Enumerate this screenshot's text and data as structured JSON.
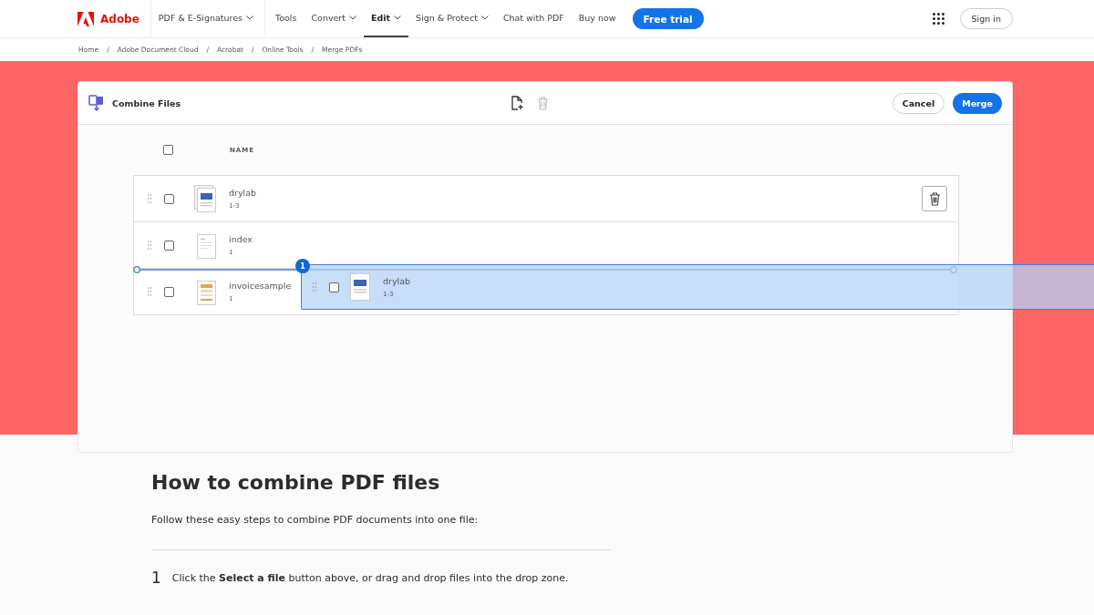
{
  "nav": {
    "logo": "Adobe",
    "items": [
      {
        "label": "PDF & E-Signatures",
        "dropdown": true,
        "selected": false
      },
      {
        "label": "Tools",
        "dropdown": false,
        "selected": false
      },
      {
        "label": "Convert",
        "dropdown": true,
        "selected": false
      },
      {
        "label": "Edit",
        "dropdown": true,
        "selected": true
      },
      {
        "label": "Sign & Protect",
        "dropdown": true,
        "selected": false
      },
      {
        "label": "Chat with PDF",
        "dropdown": false,
        "selected": false
      },
      {
        "label": "Buy now",
        "dropdown": false,
        "selected": false
      }
    ],
    "cta": "Free trial",
    "sign_in": "Sign in"
  },
  "breadcrumb": [
    "Home",
    "Adobe Document Cloud",
    "Acrobat",
    "Online Tools",
    "Merge PDFs"
  ],
  "breadcrumb_separator": "/",
  "panel": {
    "title": "Combine Files",
    "cancel": "Cancel",
    "merge": "Merge",
    "column": "NAME",
    "select_all_checked": false,
    "files": [
      {
        "name": "drylab",
        "pages": "1-3",
        "checked": false,
        "hovered": true,
        "kind": "stack"
      },
      {
        "name": "index",
        "pages": "1",
        "checked": false,
        "hovered": false,
        "kind": "plain"
      },
      {
        "name": "invoicesample",
        "pages": "1",
        "checked": false,
        "hovered": false,
        "kind": "invoice"
      }
    ],
    "drag": {
      "name": "drylab",
      "pages": "1-3",
      "badge": "1",
      "checked": false
    }
  },
  "howto": {
    "title": "How to combine PDF files",
    "intro": "Follow these easy steps to combine PDF documents into one file:",
    "steps": [
      {
        "number": "1",
        "text": "Click the **Select a file** button above, or drag and drop files into the drop zone."
      }
    ]
  }
}
